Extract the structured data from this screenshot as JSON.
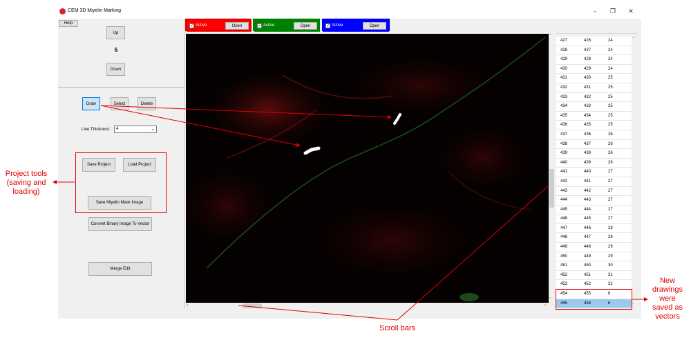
{
  "window": {
    "title": "CEM 3D Miyelin Marking",
    "controls": {
      "minimize": "–",
      "restore": "❐",
      "close": "✕"
    }
  },
  "left_panel": {
    "help_label": "Help",
    "up_label": "Up",
    "counter": "6",
    "down_label": "Down",
    "draw_label": "Draw",
    "select_label": "Select",
    "delete_label": "Delete",
    "line_thickness_label": "Line Thickness:",
    "line_thickness_value": "4",
    "save_project_label": "Save Project",
    "load_project_label": "Load Project",
    "save_mask_label": "Save Miyelin Mask Image",
    "convert_label": "Convert Binary Image To Vector",
    "merge_label": "Merge Edit"
  },
  "channels": [
    {
      "label": "Active",
      "open_label": "Open",
      "color": "#ff0000"
    },
    {
      "label": "Active",
      "open_label": "Open",
      "color": "#008000"
    },
    {
      "label": "Active",
      "open_label": "Open",
      "color": "#0000ff"
    }
  ],
  "table": {
    "rows": [
      [
        "427",
        "426",
        "24"
      ],
      [
        "428",
        "427",
        "24"
      ],
      [
        "429",
        "428",
        "24"
      ],
      [
        "430",
        "429",
        "24"
      ],
      [
        "431",
        "430",
        "25"
      ],
      [
        "432",
        "431",
        "25"
      ],
      [
        "433",
        "432",
        "25"
      ],
      [
        "434",
        "433",
        "25"
      ],
      [
        "435",
        "434",
        "25"
      ],
      [
        "436",
        "435",
        "25"
      ],
      [
        "437",
        "436",
        "26"
      ],
      [
        "438",
        "437",
        "26"
      ],
      [
        "439",
        "438",
        "26"
      ],
      [
        "440",
        "439",
        "26"
      ],
      [
        "441",
        "440",
        "27"
      ],
      [
        "442",
        "441",
        "27"
      ],
      [
        "443",
        "442",
        "27"
      ],
      [
        "444",
        "443",
        "27"
      ],
      [
        "445",
        "444",
        "27"
      ],
      [
        "446",
        "445",
        "27"
      ],
      [
        "447",
        "446",
        "28"
      ],
      [
        "448",
        "447",
        "28"
      ],
      [
        "449",
        "448",
        "29"
      ],
      [
        "450",
        "449",
        "29"
      ],
      [
        "451",
        "450",
        "30"
      ],
      [
        "452",
        "451",
        "31"
      ],
      [
        "453",
        "452",
        "32"
      ],
      [
        "454",
        "455",
        "6"
      ],
      [
        "455",
        "458",
        "6"
      ]
    ],
    "selected_index": 28
  },
  "annotations": {
    "project_tools": "Project tools (saving and loading)",
    "scroll_bars": "Scroll bars",
    "new_drawings": "New drawings were saved as vectors"
  }
}
